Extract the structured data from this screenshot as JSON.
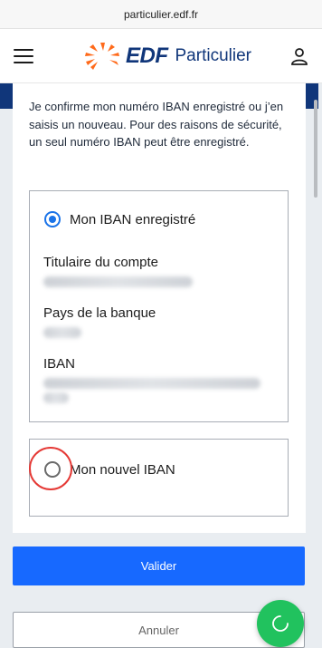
{
  "browser": {
    "url": "particulier.edf.fr"
  },
  "header": {
    "logo_edf": "EDF",
    "logo_particulier": "Particulier"
  },
  "content": {
    "intro_text": "Je confirme mon numéro IBAN enregistré ou j’en saisis un nouveau. Pour des raisons de sécurité, un seul numéro IBAN peut être enregistré.",
    "option_registered": {
      "label": "Mon IBAN enregistré",
      "selected": true,
      "fields": [
        {
          "label": "Titulaire du compte"
        },
        {
          "label": "Pays de la banque"
        },
        {
          "label": "IBAN"
        }
      ]
    },
    "option_new": {
      "label": "Mon nouvel IBAN",
      "selected": false
    }
  },
  "actions": {
    "validate_label": "Valider",
    "cancel_label": "Annuler"
  },
  "colors": {
    "brand_blue": "#10367a",
    "primary_button": "#1769ff",
    "radio_selected": "#1a73e8",
    "fab_green": "#21c25e",
    "highlight_ring": "#e53935"
  }
}
